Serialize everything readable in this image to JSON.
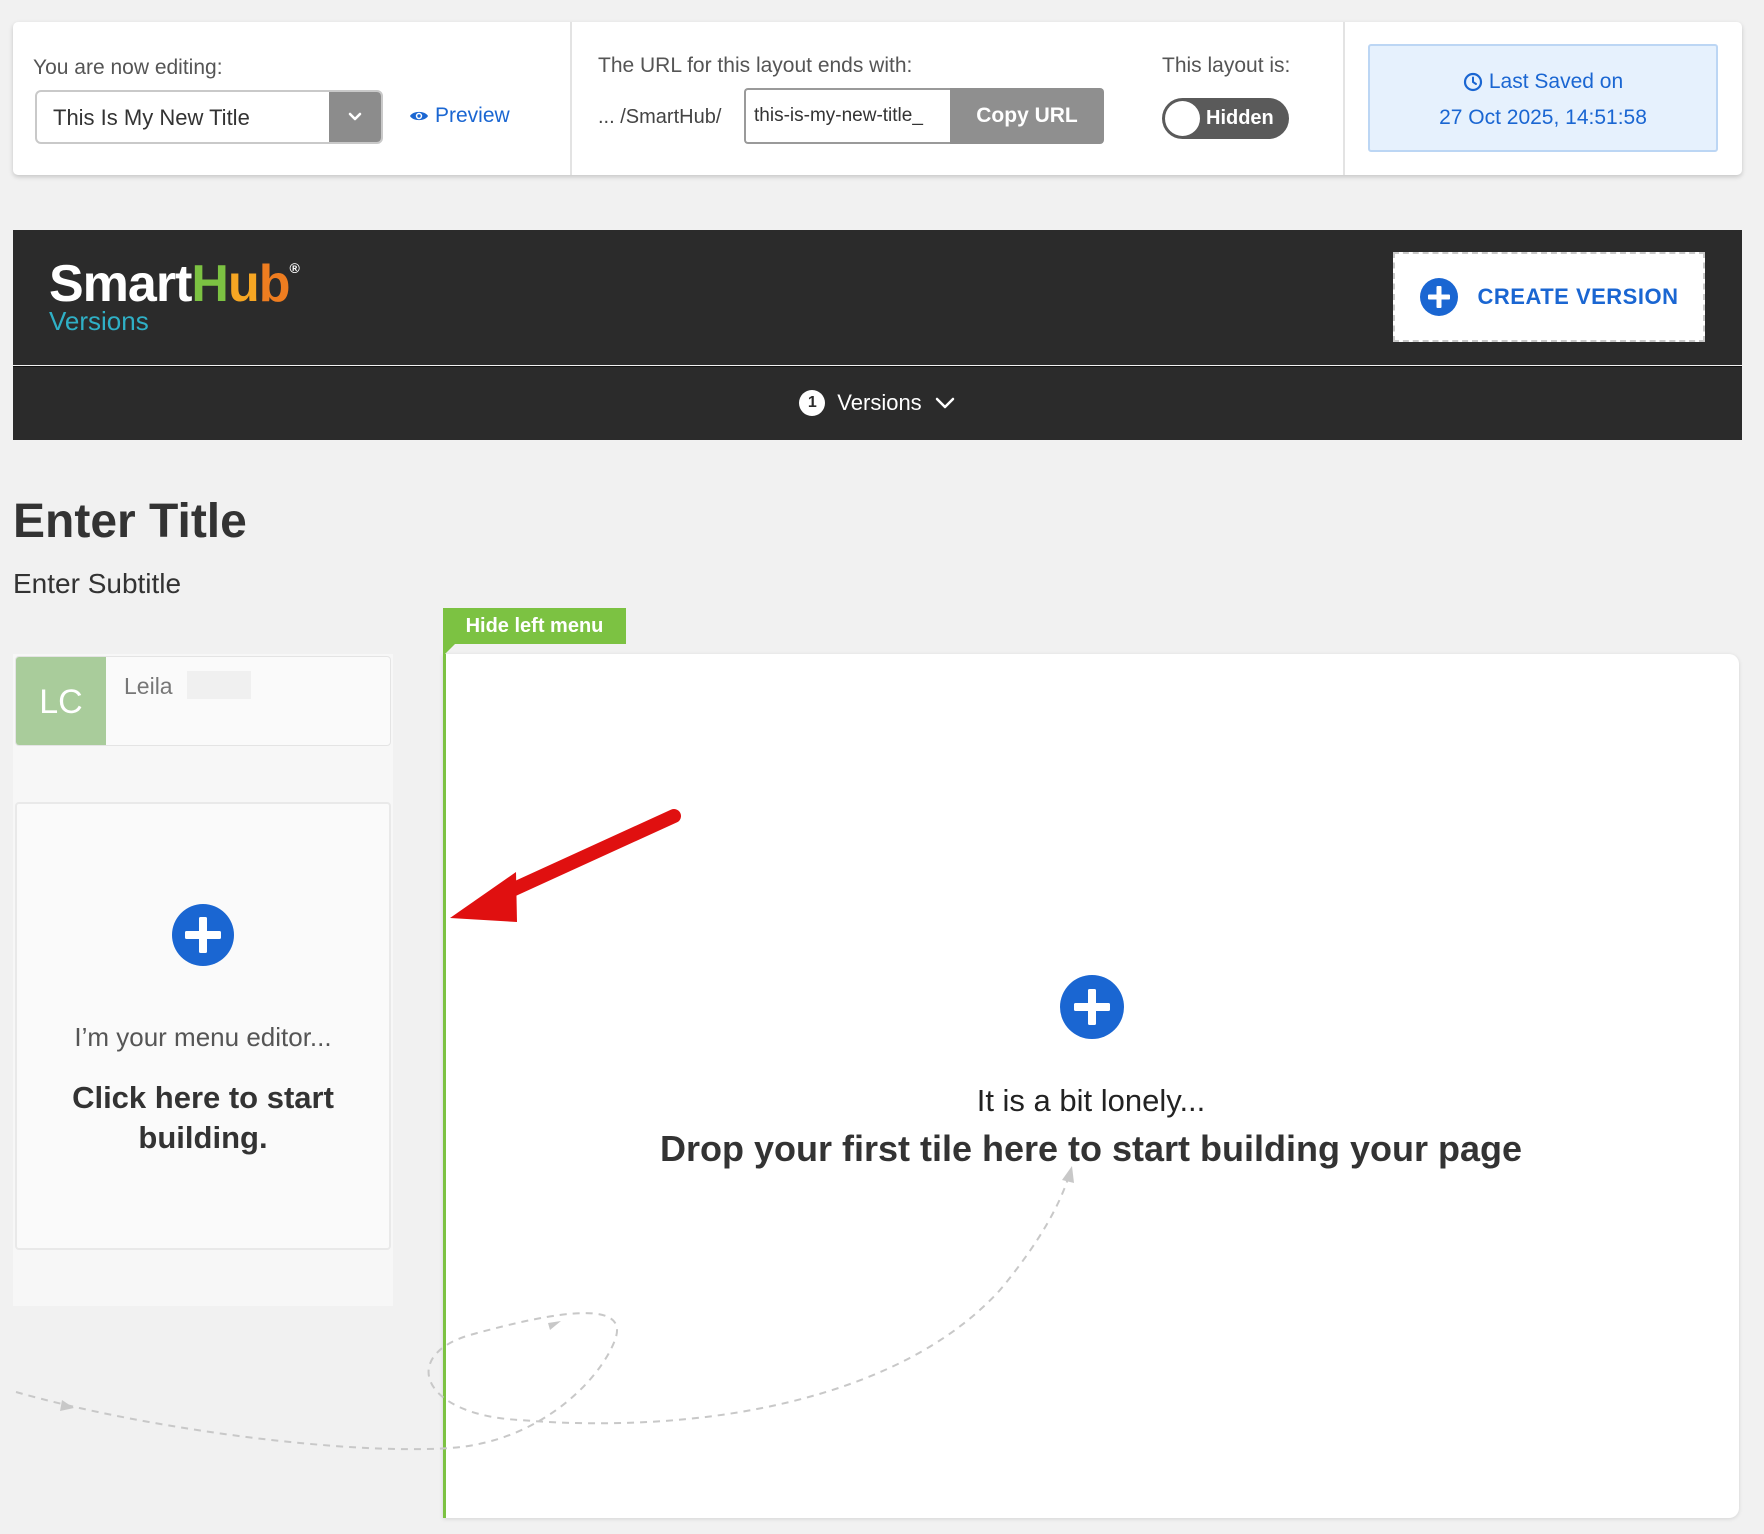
{
  "editor_bar": {
    "editing_label": "You are now editing:",
    "current_title": "This Is My New Title",
    "preview_label": "Preview",
    "url_label": "The URL for this layout ends with:",
    "url_prefix": "... /SmartHub/",
    "url_slug": "this-is-my-new-title_",
    "copy_url_label": "Copy URL",
    "layout_status_label": "This layout is:",
    "layout_status": "Hidden",
    "last_saved_label": "Last Saved on",
    "last_saved_time": "27 Oct 2025, 14:51:58"
  },
  "header": {
    "logo_text_parts": [
      "Smart",
      "H",
      "u",
      "b"
    ],
    "logo_registered": "®",
    "logo_subtitle": "Versions",
    "create_version_label": "CREATE VERSION",
    "versions_count": "1",
    "versions_label": "Versions"
  },
  "page": {
    "title": "Enter Title",
    "subtitle": "Enter Subtitle"
  },
  "left_menu": {
    "avatar_initials": "LC",
    "user_first_name": "Leila",
    "menu_editor_text": "I’m your menu editor...",
    "menu_editor_cta": "Click here to start building."
  },
  "canvas": {
    "hide_left_menu_label": "Hide left menu",
    "lonely_text": "It is a bit lonely...",
    "drop_text": "Drop your first tile here to start building your page"
  },
  "colors": {
    "accent_blue": "#1a66d2",
    "accent_green": "#7cc242",
    "header_dark": "#2b2b2b",
    "annotation_red": "#e01010"
  },
  "icons": {
    "preview": "eye-icon",
    "last_saved": "clock-icon",
    "create_version": "plus-circle-icon",
    "versions_dropdown": "chevron-down-icon",
    "title_dropdown": "chevron-down-icon",
    "annotation": "red-arrow-icon"
  }
}
